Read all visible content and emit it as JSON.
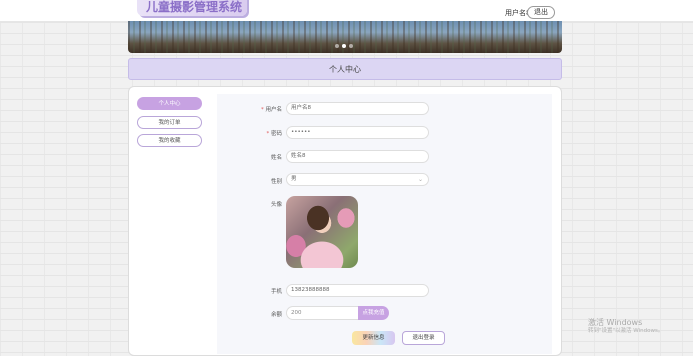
{
  "header": {
    "logo_text": "儿童摄影管理系统",
    "username": "用户名8",
    "logout_label": "退出"
  },
  "banner": {
    "slide_count": 3,
    "active_slide": 2
  },
  "page_title": "个人中心",
  "sidebar": {
    "items": [
      {
        "label": "个人中心",
        "active": true
      },
      {
        "label": "我的订单",
        "active": false
      },
      {
        "label": "我的收藏",
        "active": false
      }
    ]
  },
  "form": {
    "username": {
      "label": "用户名",
      "required": "*",
      "value": "用户名8"
    },
    "password": {
      "label": "密码",
      "required": "*",
      "value": "••••••"
    },
    "name": {
      "label": "姓名",
      "value": "姓名8"
    },
    "gender": {
      "label": "性别",
      "value": "男"
    },
    "avatar": {
      "label": "头像"
    },
    "phone": {
      "label": "手机",
      "value": "13823888888"
    },
    "balance": {
      "label": "余额",
      "value": "200",
      "recharge_label": "点我充值"
    },
    "update_label": "更新信息",
    "logout_label": "退出登录"
  },
  "watermark": {
    "line1": "激活 Windows",
    "line2": "转到\"设置\"以激活 Windows。"
  },
  "colors": {
    "accent": "#c7a2e2",
    "header_bg": "#dcd6f3",
    "required": "#e05a5a"
  }
}
